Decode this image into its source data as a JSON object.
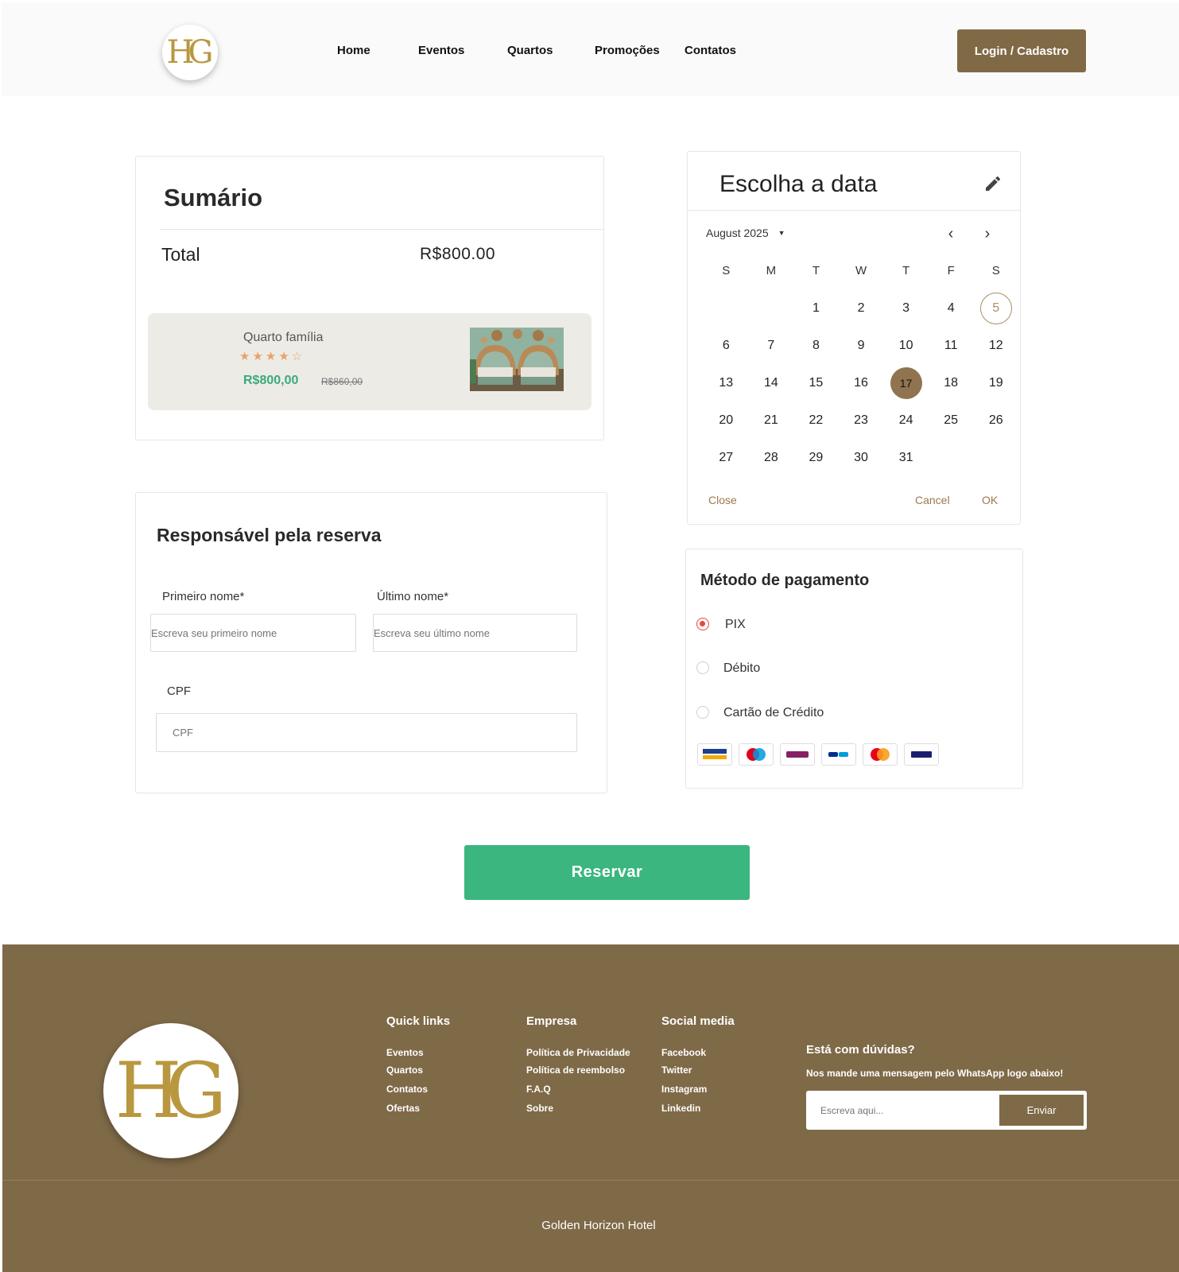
{
  "header": {
    "logo_text": "HG",
    "nav": [
      "Home",
      "Eventos",
      "Quartos",
      "Promoções",
      "Contatos"
    ],
    "login_label": "Login / Cadastro"
  },
  "summary": {
    "title": "Sumário",
    "total_label": "Total",
    "total_value": "R$800.00",
    "room": {
      "name": "Quarto família",
      "stars": "★★★★☆",
      "rating": 4,
      "rating_max": 5,
      "price": "R$800,00",
      "old_price": "R$860,00"
    }
  },
  "responsible": {
    "title": "Responsável pela reserva",
    "first_name_label": "Primeiro nome*",
    "first_name_placeholder": "Escreva seu primeiro nome",
    "last_name_label": "Último nome*",
    "last_name_placeholder": "Escreva seu último nome",
    "cpf_label": "CPF",
    "cpf_placeholder": "CPF"
  },
  "calendar": {
    "title": "Escolha a data",
    "month_label": "August 2025",
    "weekdays": [
      "S",
      "M",
      "T",
      "W",
      "T",
      "F",
      "S"
    ],
    "weeks": [
      [
        "",
        "",
        "1",
        "2",
        "3",
        "4",
        "5"
      ],
      [
        "6",
        "7",
        "8",
        "9",
        "10",
        "11",
        "12"
      ],
      [
        "13",
        "14",
        "15",
        "16",
        "17",
        "18",
        "19"
      ],
      [
        "20",
        "21",
        "22",
        "23",
        "24",
        "25",
        "26"
      ],
      [
        "27",
        "28",
        "29",
        "30",
        "31",
        "",
        ""
      ]
    ],
    "today": "5",
    "selected": "17",
    "close_label": "Close",
    "cancel_label": "Cancel",
    "ok_label": "OK"
  },
  "payment": {
    "title": "Método de pagamento",
    "options": [
      "PIX",
      "Débito",
      "Cartão de Crédito"
    ],
    "selected": "PIX",
    "card_logos": [
      "visa-electron",
      "maestro",
      "skrill",
      "paypal",
      "mastercard",
      "visa"
    ]
  },
  "reserve_label": "Reservar",
  "footer": {
    "quick_links": {
      "title": "Quick links",
      "items": [
        "Eventos",
        "Quartos",
        "Contatos",
        "Ofertas"
      ]
    },
    "company": {
      "title": "Empresa",
      "items": [
        "Política de Privacidade",
        "Política de reembolso",
        "F.A.Q",
        "Sobre"
      ]
    },
    "social": {
      "title": "Social media",
      "items": [
        "Facebook",
        "Twitter",
        "Instagram",
        "Linkedin"
      ]
    },
    "faq_title": "Está com dúvidas?",
    "faq_subtitle": "Nos mande uma mensagem pelo WhatsApp logo abaixo!",
    "faq_placeholder": "Escreva aqui...",
    "send_label": "Enviar",
    "copyright": "Golden Horizon Hotel"
  },
  "colors": {
    "brand": "#806a46",
    "accent_green": "#3bb67f",
    "star": "#e9a26b",
    "radio_selected": "#e64a3b"
  }
}
